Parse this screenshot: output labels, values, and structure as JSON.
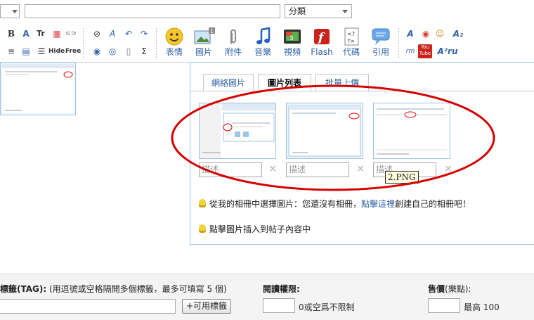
{
  "top": {
    "title_value": "",
    "category_selected": "分類"
  },
  "toolbar": {
    "small": [
      {
        "name": "bold-icon",
        "glyph": "B"
      },
      {
        "name": "font-size-icon",
        "glyph": "A"
      },
      {
        "name": "font-tt-icon",
        "glyph": "Tr"
      },
      {
        "name": "color-grid-icon",
        "glyph": "▦"
      },
      {
        "name": "link-icon",
        "glyph": "⊂⊃"
      },
      {
        "name": "unlink-icon",
        "glyph": "⊘"
      },
      {
        "name": "clear-format-icon",
        "glyph": "A"
      },
      {
        "name": "undo-icon",
        "glyph": "↶"
      },
      {
        "name": "redo-icon",
        "glyph": "↷"
      },
      {
        "name": "align-icon",
        "glyph": "≡"
      },
      {
        "name": "table-icon",
        "glyph": "▤"
      },
      {
        "name": "list-icon",
        "glyph": "☰"
      },
      {
        "name": "hide-icon",
        "glyph": "Hide"
      },
      {
        "name": "free-icon",
        "glyph": "Free"
      },
      {
        "name": "media-icon",
        "glyph": "◉"
      },
      {
        "name": "emoticon-small-icon",
        "glyph": "◎"
      },
      {
        "name": "page-icon",
        "glyph": "▯"
      },
      {
        "name": "sum-icon",
        "glyph": "Σ"
      }
    ],
    "big": [
      {
        "name": "emoticon",
        "label": "表情"
      },
      {
        "name": "image",
        "label": "圖片"
      },
      {
        "name": "attachment",
        "label": "附件"
      },
      {
        "name": "music",
        "label": "音樂"
      },
      {
        "name": "video",
        "label": "視頻"
      },
      {
        "name": "flash",
        "label": "Flash"
      },
      {
        "name": "code",
        "label": "代碼"
      },
      {
        "name": "quote",
        "label": "引用"
      }
    ],
    "right_icons": [
      "A",
      "◉",
      "☺",
      "A₂",
      "rm",
      "You Tube",
      "A²ru"
    ]
  },
  "panel": {
    "tabs": [
      "網絡圖片",
      "圖片列表",
      "批量上傳"
    ],
    "active_tab": "圖片列表",
    "desc_placeholder": "描述",
    "tooltip": "2.PNG",
    "hint1_prefix": "從我的相冊中選擇圖片：您還沒有相冊，",
    "hint1_link": "點擊這裡",
    "hint1_suffix": "創建自己的相冊吧！",
    "hint2": "點擊圖片插入到帖子內容中",
    "delete_glyph": "×"
  },
  "bottom": {
    "tag_label_bold": "標籤(TAG):",
    "tag_label_rest": "(用逗號或空格隔開多個標籤，最多可填寫 5 個)",
    "tag_button": "+可用標籤",
    "read_label": "閱讀權限:",
    "read_note": "0或空爲不限制",
    "price_label": "售價",
    "price_unit": "(樂點):",
    "price_note": "最高 100"
  },
  "colors": {
    "accent": "#2f62a6",
    "border_blue": "#9ec4e6",
    "circle": "#d40000"
  }
}
